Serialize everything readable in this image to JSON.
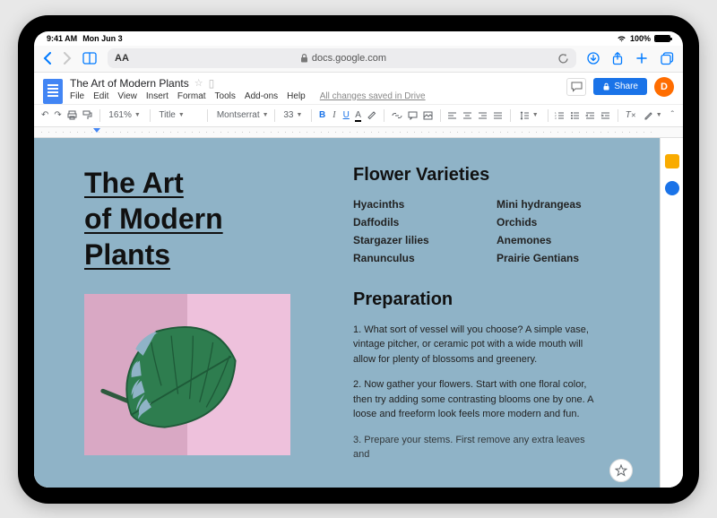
{
  "status": {
    "time": "9:41 AM",
    "date": "Mon Jun 3",
    "battery": "100%"
  },
  "safari": {
    "url": "docs.google.com",
    "aa": "AA"
  },
  "docs": {
    "doc_title": "The Art of Modern Plants",
    "menus": {
      "file": "File",
      "edit": "Edit",
      "view": "View",
      "insert": "Insert",
      "format": "Format",
      "tools": "Tools",
      "addons": "Add-ons",
      "help": "Help"
    },
    "save_status": "All changes saved in Drive",
    "share_label": "Share",
    "avatar_initial": "D",
    "zoom": "161%",
    "style": "Title",
    "font": "Montserrat",
    "font_size": "33"
  },
  "content": {
    "title_line1": "The Art",
    "title_line2": "of Modern",
    "title_line3": "Plants",
    "section_varieties": "Flower Varieties",
    "varieties": {
      "v0": "Hyacinths",
      "v1": "Mini hydrangeas",
      "v2": "Daffodils",
      "v3": "Orchids",
      "v4": "Stargazer lilies",
      "v5": "Anemones",
      "v6": "Ranunculus",
      "v7": "Prairie Gentians"
    },
    "section_prep": "Preparation",
    "prep1": "1. What sort of vessel will you choose? A simple vase, vintage pitcher, or ceramic pot with a wide mouth will allow for plenty of blossoms and greenery.",
    "prep2": "2. Now gather your flowers. Start with one floral color, then try adding some contrasting blooms one by one. A loose and freeform look feels more modern and fun.",
    "prep3": "3. Prepare your stems. First remove any extra leaves and"
  }
}
